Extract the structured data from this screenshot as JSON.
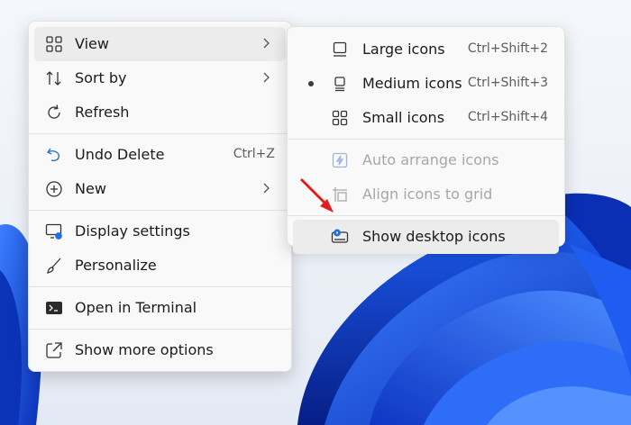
{
  "context_menu": {
    "items": [
      {
        "label": "View",
        "icon": "grid-icon",
        "submenu": true
      },
      {
        "label": "Sort by",
        "icon": "sort-icon",
        "submenu": true
      },
      {
        "label": "Refresh",
        "icon": "refresh-icon"
      },
      {
        "label": "Undo Delete",
        "icon": "undo-icon",
        "shortcut": "Ctrl+Z"
      },
      {
        "label": "New",
        "icon": "plus-circle-icon",
        "submenu": true
      },
      {
        "label": "Display settings",
        "icon": "display-settings-icon"
      },
      {
        "label": "Personalize",
        "icon": "brush-icon"
      },
      {
        "label": "Open in Terminal",
        "icon": "terminal-icon"
      },
      {
        "label": "Show more options",
        "icon": "share-arrow-icon"
      }
    ]
  },
  "view_submenu": {
    "items": [
      {
        "label": "Large icons",
        "shortcut": "Ctrl+Shift+2",
        "icon": "large-icons-icon"
      },
      {
        "label": "Medium icons",
        "shortcut": "Ctrl+Shift+3",
        "icon": "medium-icons-icon",
        "selected": true
      },
      {
        "label": "Small icons",
        "shortcut": "Ctrl+Shift+4",
        "icon": "small-icons-icon"
      },
      {
        "label": "Auto arrange icons",
        "icon": "auto-arrange-icon",
        "disabled": true
      },
      {
        "label": "Align icons to grid",
        "icon": "align-grid-icon",
        "disabled": true
      },
      {
        "label": "Show desktop icons",
        "icon": "show-desktop-icon",
        "highlighted": true
      }
    ]
  },
  "colors": {
    "accent": "#0067c0",
    "annotation_arrow": "#e01e1e",
    "wallpaper_primary": "#1b56e0"
  }
}
